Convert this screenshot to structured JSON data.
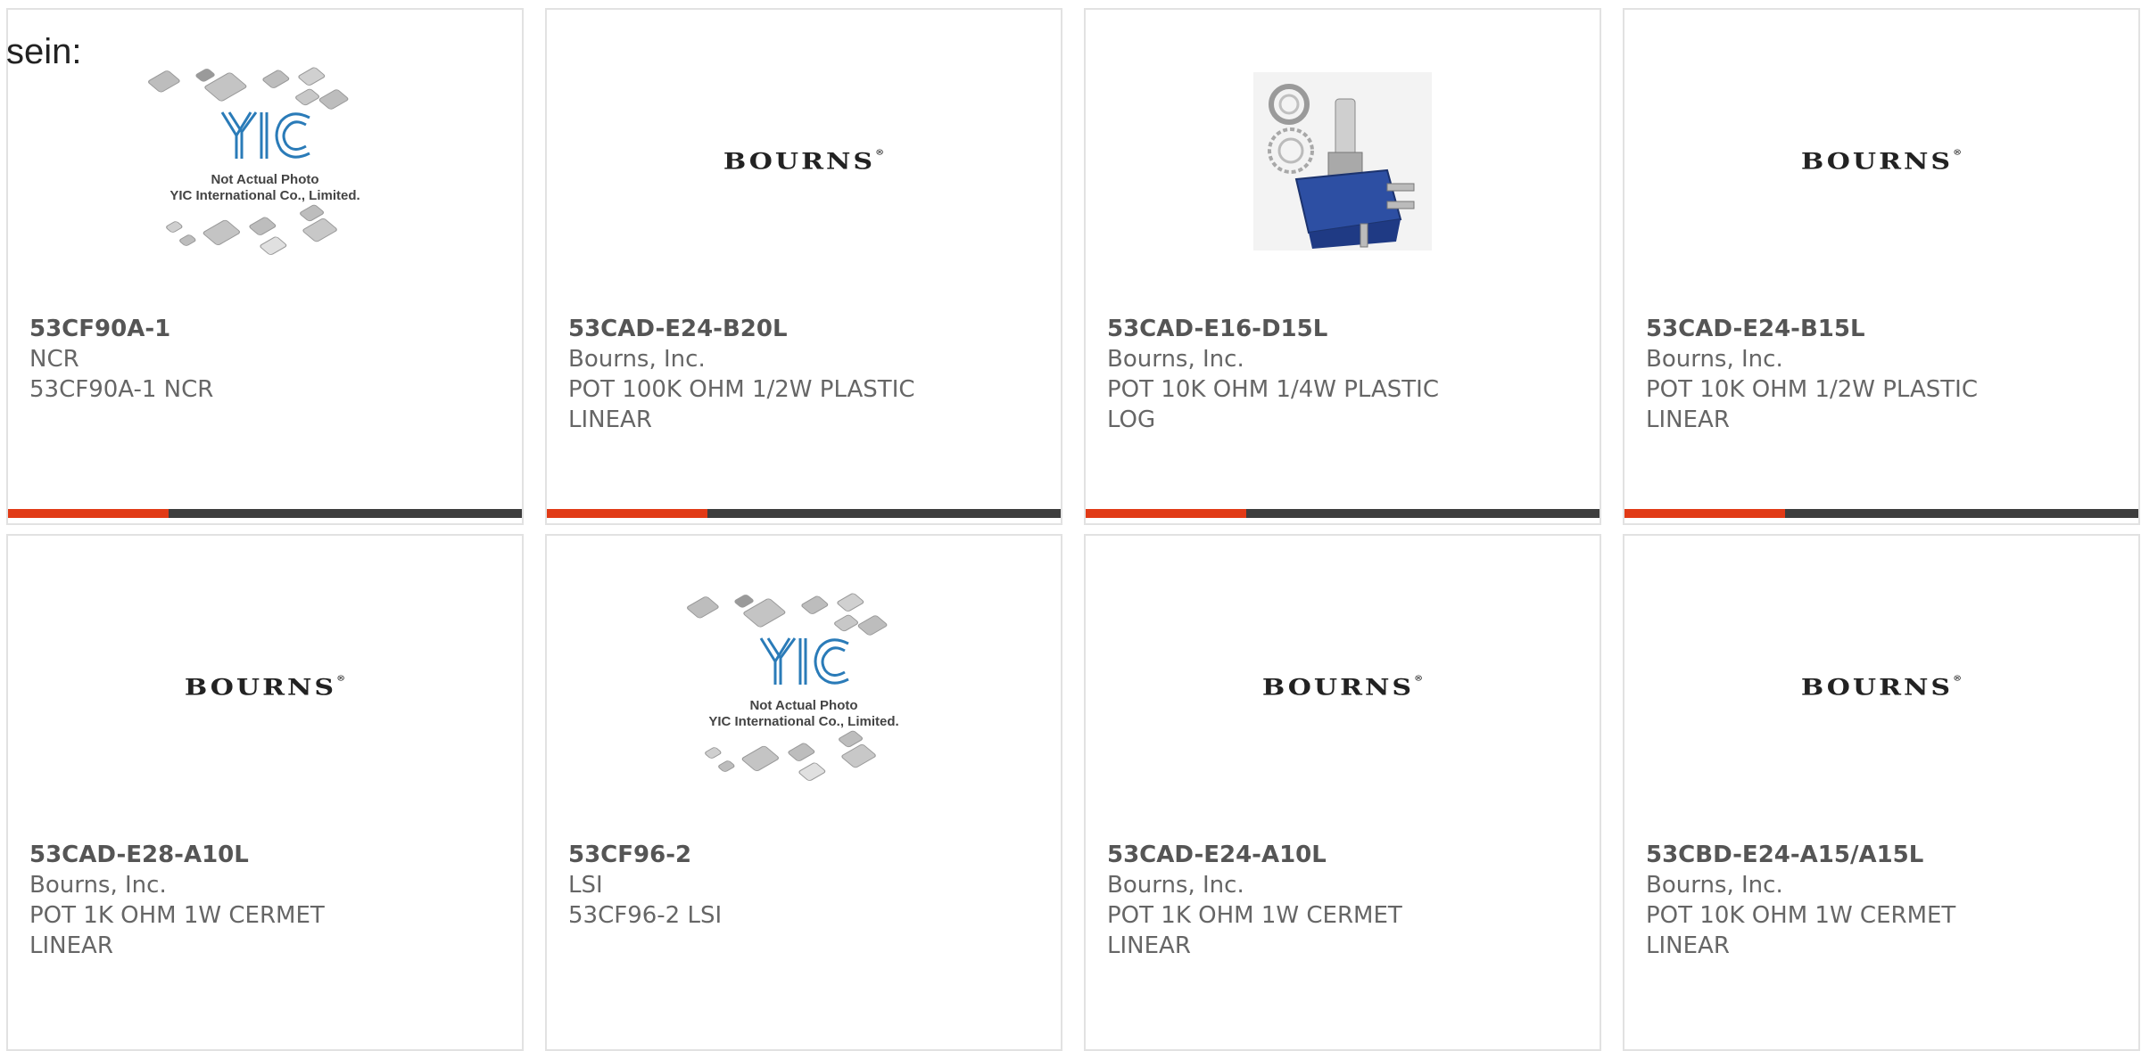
{
  "fragment_text": "sein:",
  "brand_logo_text": "BOURNS",
  "placeholder": {
    "line1": "Not Actual Photo",
    "line2": "YIC International Co., Limited."
  },
  "colors": {
    "accent": "#e13a16",
    "bar": "#3d3d3d",
    "border": "#e2e2e2"
  },
  "products": [
    {
      "part_number": "53CF90A-1",
      "manufacturer": "NCR",
      "description": "53CF90A-1 NCR",
      "image": "yic-placeholder"
    },
    {
      "part_number": "53CAD-E24-B20L",
      "manufacturer": "Bourns, Inc.",
      "description": "POT 100K OHM 1/2W PLASTIC LINEAR",
      "image": "bourns-logo"
    },
    {
      "part_number": "53CAD-E16-D15L",
      "manufacturer": "Bourns, Inc.",
      "description": "POT 10K OHM 1/4W PLASTIC LOG",
      "image": "potentiometer-photo"
    },
    {
      "part_number": "53CAD-E24-B15L",
      "manufacturer": "Bourns, Inc.",
      "description": "POT 10K OHM 1/2W PLASTIC LINEAR",
      "image": "bourns-logo"
    },
    {
      "part_number": "53CAD-E28-A10L",
      "manufacturer": "Bourns, Inc.",
      "description": "POT 1K OHM 1W CERMET LINEAR",
      "image": "bourns-logo"
    },
    {
      "part_number": "53CF96-2",
      "manufacturer": "LSI",
      "description": "53CF96-2 LSI",
      "image": "yic-placeholder"
    },
    {
      "part_number": "53CAD-E24-A10L",
      "manufacturer": "Bourns, Inc.",
      "description": "POT 1K OHM 1W CERMET LINEAR",
      "image": "bourns-logo"
    },
    {
      "part_number": "53CBD-E24-A15/A15L",
      "manufacturer": "Bourns, Inc.",
      "description": "POT 10K OHM 1W CERMET LINEAR",
      "image": "bourns-logo"
    }
  ]
}
